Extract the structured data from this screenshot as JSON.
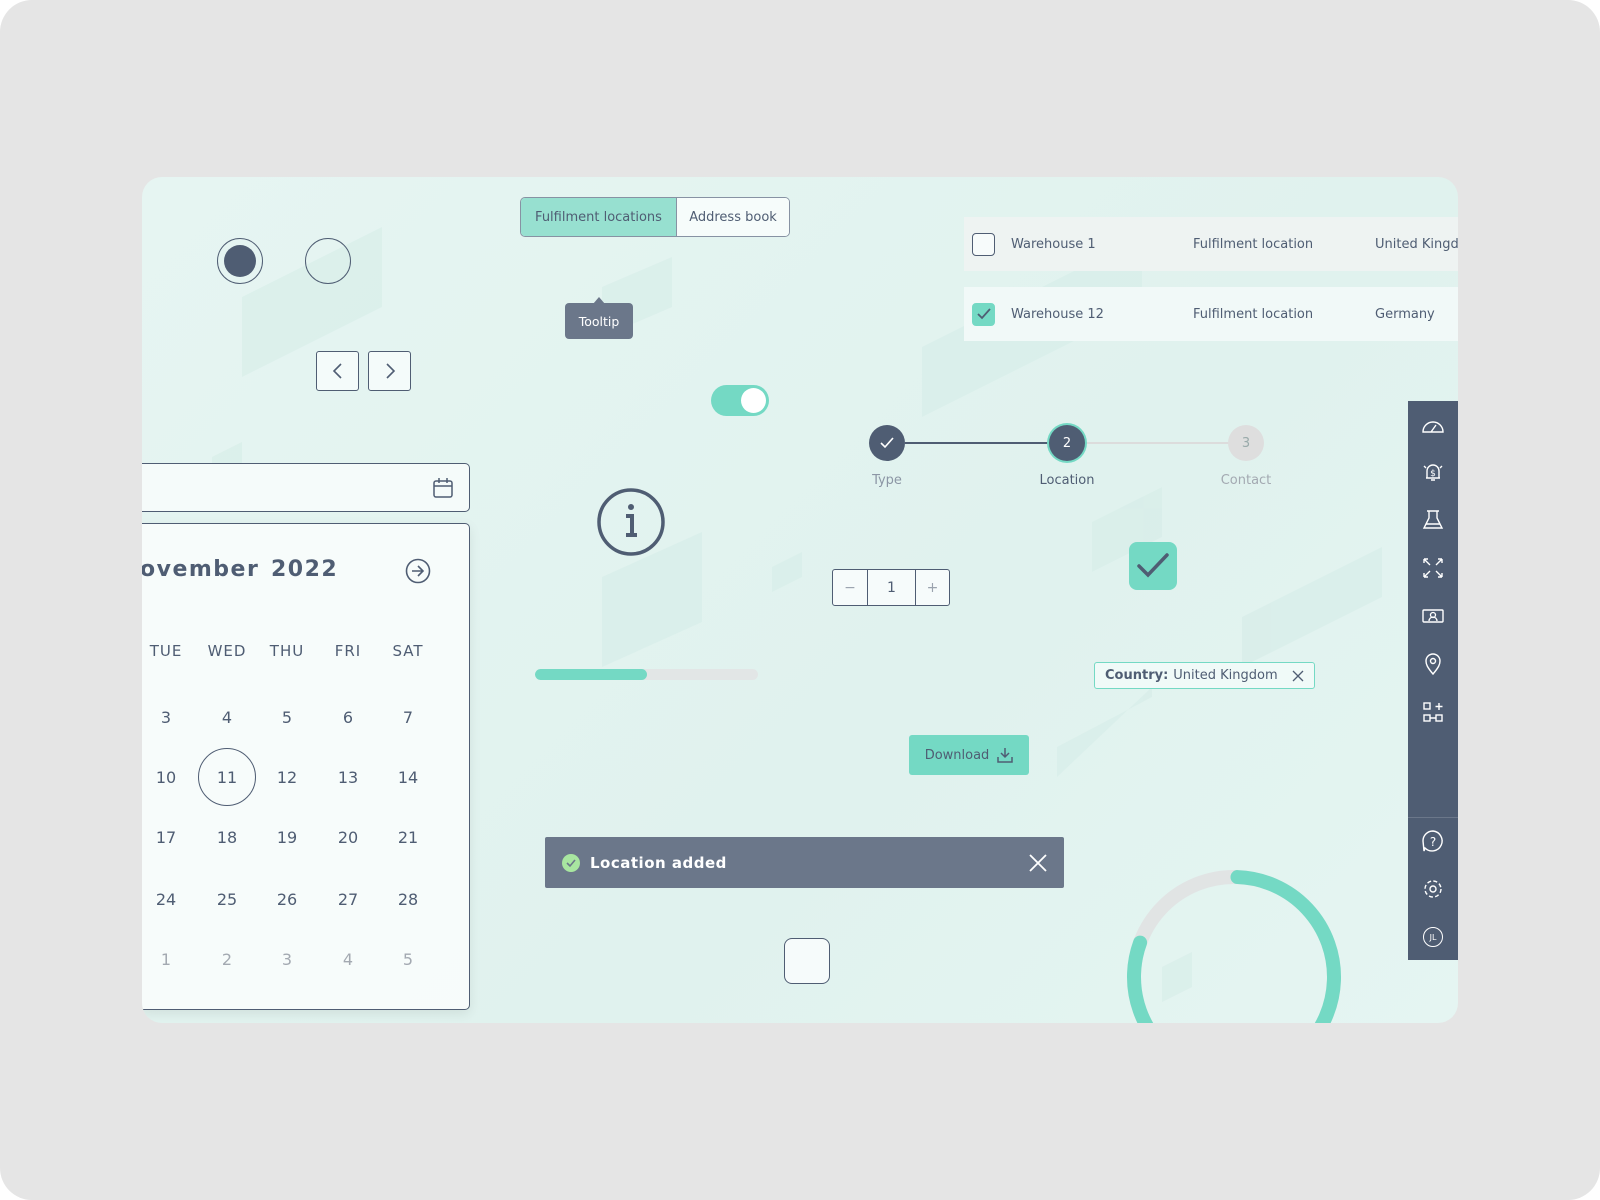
{
  "colors": {
    "accent": "#74d9c4",
    "dark": "#4f5d73",
    "toast": "#6b778a",
    "page_bg": "#e5e5e5"
  },
  "radios": [
    {
      "selected": true
    },
    {
      "selected": false
    }
  ],
  "pagination": {
    "prev_icon": "chevron-left-icon",
    "next_icon": "chevron-right-icon"
  },
  "segmented": {
    "items": [
      {
        "label": "Fulfilment locations",
        "active": true
      },
      {
        "label": "Address book",
        "active": false
      }
    ]
  },
  "tooltip": {
    "text": "Tooltip"
  },
  "table": {
    "rows": [
      {
        "checked": false,
        "name": "Warehouse 1",
        "type": "Fulfilment location",
        "country": "United Kingd"
      },
      {
        "checked": true,
        "name": "Warehouse 12",
        "type": "Fulfilment location",
        "country": "Germany"
      }
    ]
  },
  "toggle": {
    "on": true
  },
  "stepper": {
    "steps": [
      {
        "num": "1",
        "label": "Type",
        "state": "done"
      },
      {
        "num": "2",
        "label": "Location",
        "state": "current"
      },
      {
        "num": "3",
        "label": "Contact",
        "state": "upcoming"
      }
    ]
  },
  "date_input": {
    "value": "",
    "icon": "calendar-icon"
  },
  "calendar": {
    "month": "ovember",
    "year": "2022",
    "weekdays": [
      "TUE",
      "WED",
      "THU",
      "FRI",
      "SAT"
    ],
    "weeks": [
      [
        "3",
        "4",
        "5",
        "6",
        "7"
      ],
      [
        "10",
        "11",
        "12",
        "13",
        "14"
      ],
      [
        "17",
        "18",
        "19",
        "20",
        "21"
      ],
      [
        "24",
        "25",
        "26",
        "27",
        "28"
      ],
      [
        "1",
        "2",
        "3",
        "4",
        "5"
      ]
    ],
    "selected": "11"
  },
  "info_icon": "info-icon",
  "number_stepper": {
    "value": "1",
    "minus": "−",
    "plus": "+"
  },
  "big_checkbox": {
    "checked": true
  },
  "progress": {
    "value": 0.5
  },
  "filter_tag": {
    "key": "Country:",
    "value": "United Kingdom"
  },
  "download": {
    "label": "Download",
    "icon": "download-icon"
  },
  "toast": {
    "text": "Location added",
    "icon": "check-circle-icon"
  },
  "empty_checkbox": {
    "checked": false
  },
  "ring": {
    "value": 0.8
  },
  "sidebar": {
    "top": [
      "speedometer-icon",
      "alarm-dollar-icon",
      "flask-icon",
      "expand-icon",
      "money-user-icon",
      "location-pin-icon",
      "add-module-icon"
    ],
    "bottom": [
      "help-icon",
      "gear-icon"
    ],
    "avatar": "JL"
  }
}
